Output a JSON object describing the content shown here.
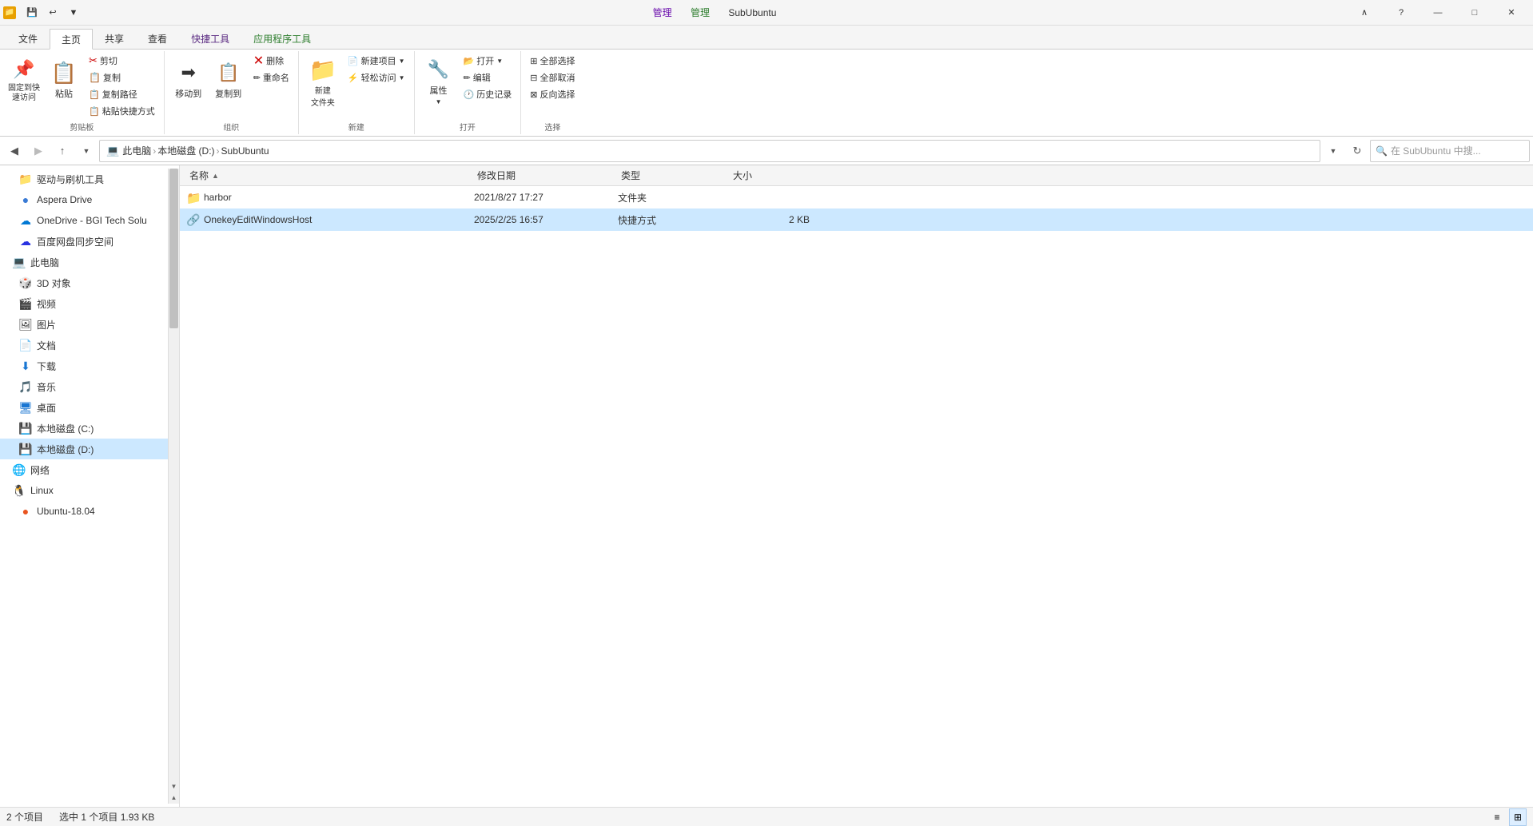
{
  "window": {
    "title": "SubUbuntu",
    "title_prefix": "管理",
    "title_prefix2": "管理"
  },
  "titlebar": {
    "icon": "📁",
    "qat": [
      "💾",
      "↩",
      "▼"
    ],
    "controls": [
      "—",
      "□",
      "✕"
    ]
  },
  "ribbon": {
    "tabs": [
      {
        "label": "文件",
        "active": false
      },
      {
        "label": "主页",
        "active": true
      },
      {
        "label": "共享",
        "active": false
      },
      {
        "label": "查看",
        "active": false
      },
      {
        "label": "快捷工具",
        "active": false,
        "highlight": true
      },
      {
        "label": "应用程序工具",
        "active": false,
        "highlight2": true
      }
    ],
    "groups": {
      "clipboard": {
        "label": "剪贴板",
        "buttons": {
          "pin": {
            "label": "固定到快\n速访问",
            "icon": "📌"
          },
          "copy": {
            "label": "复制",
            "icon": "📋"
          },
          "paste": {
            "label": "粘贴",
            "icon": "📋"
          },
          "cut": {
            "label": "剪切",
            "icon": "✂"
          },
          "copy_path": {
            "label": "复制路径"
          },
          "paste_shortcut": {
            "label": "粘贴快捷方式"
          }
        }
      },
      "organize": {
        "label": "组织",
        "buttons": {
          "move_to": {
            "label": "移动到",
            "icon": "➡"
          },
          "copy_to": {
            "label": "复制到",
            "icon": "📋"
          },
          "delete": {
            "label": "删除",
            "icon": "✕"
          },
          "rename": {
            "label": "重命名",
            "icon": "✏"
          }
        }
      },
      "new": {
        "label": "新建",
        "buttons": {
          "new_folder": {
            "label": "新建\n文件夹",
            "icon": "📁"
          },
          "new_item": {
            "label": "新建项目",
            "icon": "📄"
          },
          "easy_access": {
            "label": "轻松访问",
            "icon": "⚡"
          }
        }
      },
      "open": {
        "label": "打开",
        "buttons": {
          "properties": {
            "label": "属性",
            "icon": "🔧"
          },
          "open": {
            "label": "打开",
            "icon": "📂"
          },
          "edit": {
            "label": "编辑",
            "icon": "✏"
          },
          "history": {
            "label": "历史记录",
            "icon": "🕐"
          }
        }
      },
      "select": {
        "label": "选择",
        "buttons": {
          "select_all": {
            "label": "全部选择"
          },
          "select_none": {
            "label": "全部取消"
          },
          "invert": {
            "label": "反向选择"
          }
        }
      }
    }
  },
  "navbar": {
    "back_disabled": false,
    "forward_disabled": true,
    "up": true,
    "breadcrumb": [
      "此电脑",
      "本地磁盘 (D:)",
      "SubUbuntu"
    ],
    "search_placeholder": "在 SubUbuntu 中搜..."
  },
  "sidebar": {
    "items": [
      {
        "label": "驱动与刷机工具",
        "icon": "📁",
        "indent": 1,
        "type": "folder"
      },
      {
        "label": "Aspera Drive",
        "icon": "☁",
        "indent": 1,
        "type": "cloud"
      },
      {
        "label": "OneDrive - BGI Tech Solu",
        "icon": "☁",
        "indent": 1,
        "type": "cloud2"
      },
      {
        "label": "百度网盘同步空间",
        "icon": "☁",
        "indent": 1,
        "type": "cloud3"
      },
      {
        "label": "此电脑",
        "icon": "💻",
        "indent": 0,
        "type": "computer"
      },
      {
        "label": "3D 对象",
        "icon": "🎲",
        "indent": 1,
        "type": "folder"
      },
      {
        "label": "视频",
        "icon": "🎬",
        "indent": 1,
        "type": "folder"
      },
      {
        "label": "图片",
        "icon": "🖼",
        "indent": 1,
        "type": "folder"
      },
      {
        "label": "文档",
        "icon": "📄",
        "indent": 1,
        "type": "folder"
      },
      {
        "label": "下载",
        "icon": "⬇",
        "indent": 1,
        "type": "folder"
      },
      {
        "label": "音乐",
        "icon": "🎵",
        "indent": 1,
        "type": "folder"
      },
      {
        "label": "桌面",
        "icon": "🖥",
        "indent": 1,
        "type": "folder"
      },
      {
        "label": "本地磁盘 (C:)",
        "icon": "💾",
        "indent": 1,
        "type": "drive"
      },
      {
        "label": "本地磁盘 (D:)",
        "icon": "💾",
        "indent": 1,
        "type": "drive",
        "selected": true
      },
      {
        "label": "网络",
        "icon": "🌐",
        "indent": 0,
        "type": "network"
      },
      {
        "label": "Linux",
        "icon": "🐧",
        "indent": 0,
        "type": "linux"
      },
      {
        "label": "Ubuntu-18.04",
        "icon": "🟠",
        "indent": 1,
        "type": "ubuntu"
      }
    ]
  },
  "file_list": {
    "columns": [
      {
        "key": "name",
        "label": "名称"
      },
      {
        "key": "date",
        "label": "修改日期"
      },
      {
        "key": "type",
        "label": "类型"
      },
      {
        "key": "size",
        "label": "大小"
      }
    ],
    "files": [
      {
        "name": "harbor",
        "date": "2021/8/27 17:27",
        "type": "文件夹",
        "size": "",
        "icon": "folder",
        "selected": false
      },
      {
        "name": "OnekeyEditWindowsHost",
        "date": "2025/2/25 16:57",
        "type": "快捷方式",
        "size": "2 KB",
        "icon": "shortcut",
        "selected": true
      }
    ]
  },
  "statusbar": {
    "count": "2 个项目",
    "selected": "选中 1 个项目  1.93 KB"
  }
}
